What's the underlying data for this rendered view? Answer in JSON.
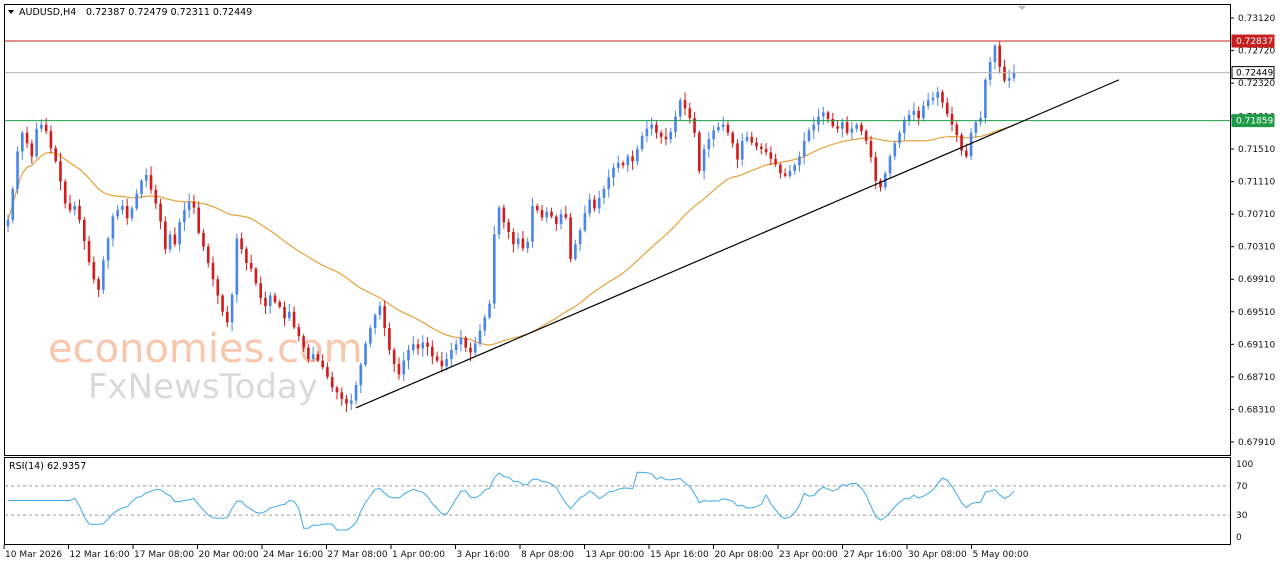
{
  "header": {
    "symbol": "AUDUSD,H4",
    "ohlc": "0.72387 0.72479 0.72311 0.72449"
  },
  "watermark": {
    "line1": "economies.com",
    "line2": "FxNewsToday"
  },
  "price_panel": {
    "y_ticks": [
      "0.73120",
      "0.72720",
      "0.72320",
      "0.71910",
      "0.71510",
      "0.71110",
      "0.70710",
      "0.70310",
      "0.69910",
      "0.69510",
      "0.69110",
      "0.68710",
      "0.68310",
      "0.67910"
    ],
    "resistance_label": "0.72837",
    "current_price_label": "0.72449",
    "support_label": "0.71859"
  },
  "rsi_panel": {
    "label": "RSI(14) 62.9357",
    "y_ticks": [
      "100",
      "70",
      "30",
      "0"
    ]
  },
  "x_labels": [
    "10 Mar 2026",
    "12 Mar 16:00",
    "17 Mar 08:00",
    "20 Mar 00:00",
    "24 Mar 16:00",
    "27 Mar 08:00",
    "1 Apr 00:00",
    "3 Apr 16:00",
    "8 Apr 08:00",
    "13 Apr 00:00",
    "15 Apr 16:00",
    "20 Apr 08:00",
    "23 Apr 00:00",
    "27 Apr 16:00",
    "30 Apr 08:00",
    "5 May 00:00"
  ],
  "colors": {
    "bull": "#4a86e8",
    "bear": "#d21c1c",
    "ma": "#e6a13c",
    "resistance": "#c81e1e",
    "support": "#1f9b48",
    "trendline": "#000000",
    "rsi": "#3fa9e6"
  },
  "chart_data": {
    "type": "candlestick",
    "symbol": "AUDUSD",
    "timeframe": "H4",
    "ylim": [
      0.6775,
      0.7328
    ],
    "horizontal_lines": {
      "resistance": 0.72837,
      "current": 0.72449,
      "support": 0.71859
    },
    "trendline": {
      "start": {
        "bar": 73,
        "price": 0.6833
      },
      "end": {
        "bar": 233,
        "price": 0.7236
      }
    },
    "closes": [
      0.7064,
      0.7102,
      0.7148,
      0.7171,
      0.7158,
      0.7142,
      0.7176,
      0.7181,
      0.7173,
      0.7152,
      0.7136,
      0.7111,
      0.7084,
      0.7076,
      0.7081,
      0.7064,
      0.7038,
      0.7012,
      0.6991,
      0.6978,
      0.7014,
      0.7041,
      0.7068,
      0.7076,
      0.7081,
      0.7066,
      0.7078,
      0.7096,
      0.7112,
      0.7119,
      0.7101,
      0.7084,
      0.7062,
      0.7028,
      0.7046,
      0.7034,
      0.7061,
      0.7076,
      0.7086,
      0.7079,
      0.7048,
      0.7031,
      0.7011,
      0.6991,
      0.6971,
      0.6951,
      0.6938,
      0.6972,
      0.7041,
      0.7028,
      0.7011,
      0.7004,
      0.6986,
      0.6968,
      0.6958,
      0.6971,
      0.6963,
      0.6957,
      0.6943,
      0.6951,
      0.6932,
      0.6921,
      0.6907,
      0.6893,
      0.6899,
      0.6891,
      0.6883,
      0.6871,
      0.6858,
      0.6852,
      0.6844,
      0.6838,
      0.6842,
      0.6861,
      0.6886,
      0.6912,
      0.6931,
      0.6947,
      0.6958,
      0.6931,
      0.6904,
      0.6887,
      0.6874,
      0.6891,
      0.6904,
      0.6911,
      0.6906,
      0.6913,
      0.6908,
      0.6896,
      0.6891,
      0.6884,
      0.6893,
      0.6904,
      0.6911,
      0.6919,
      0.6907,
      0.6901,
      0.6912,
      0.6928,
      0.6944,
      0.6961,
      0.7046,
      0.7079,
      0.7061,
      0.7049,
      0.7034,
      0.7041,
      0.7029,
      0.7037,
      0.7081,
      0.7076,
      0.7067,
      0.7074,
      0.7068,
      0.7059,
      0.7071,
      0.7067,
      0.7016,
      0.7034,
      0.7051,
      0.7072,
      0.7089,
      0.7078,
      0.7091,
      0.7102,
      0.7116,
      0.7128,
      0.7134,
      0.7131,
      0.7142,
      0.7136,
      0.7151,
      0.7167,
      0.7176,
      0.7181,
      0.7171,
      0.7166,
      0.7163,
      0.7172,
      0.7191,
      0.7211,
      0.7201,
      0.7189,
      0.7171,
      0.7124,
      0.7151,
      0.7163,
      0.7174,
      0.7178,
      0.7181,
      0.7171,
      0.7158,
      0.7138,
      0.7161,
      0.7166,
      0.7159,
      0.7154,
      0.7151,
      0.7147,
      0.7139,
      0.7132,
      0.7121,
      0.7118,
      0.7124,
      0.7131,
      0.7142,
      0.7161,
      0.7174,
      0.7181,
      0.7191,
      0.7196,
      0.7188,
      0.7179,
      0.7176,
      0.7184,
      0.7171,
      0.7176,
      0.7181,
      0.7173,
      0.7161,
      0.7141,
      0.7112,
      0.7104,
      0.7121,
      0.7142,
      0.7158,
      0.7171,
      0.7186,
      0.7193,
      0.7198,
      0.7189,
      0.7204,
      0.7211,
      0.7214,
      0.7221,
      0.7208,
      0.7194,
      0.7181,
      0.7168,
      0.7149,
      0.7142,
      0.7171,
      0.7184,
      0.7189,
      0.7236,
      0.7258,
      0.7278,
      0.7252,
      0.7235,
      0.7238,
      0.7245
    ],
    "ma_period": 50,
    "rsi_period": 14,
    "rsi_last": 62.9357,
    "rsi_levels": [
      70,
      30
    ],
    "rsi_ylim": [
      0,
      100
    ]
  }
}
